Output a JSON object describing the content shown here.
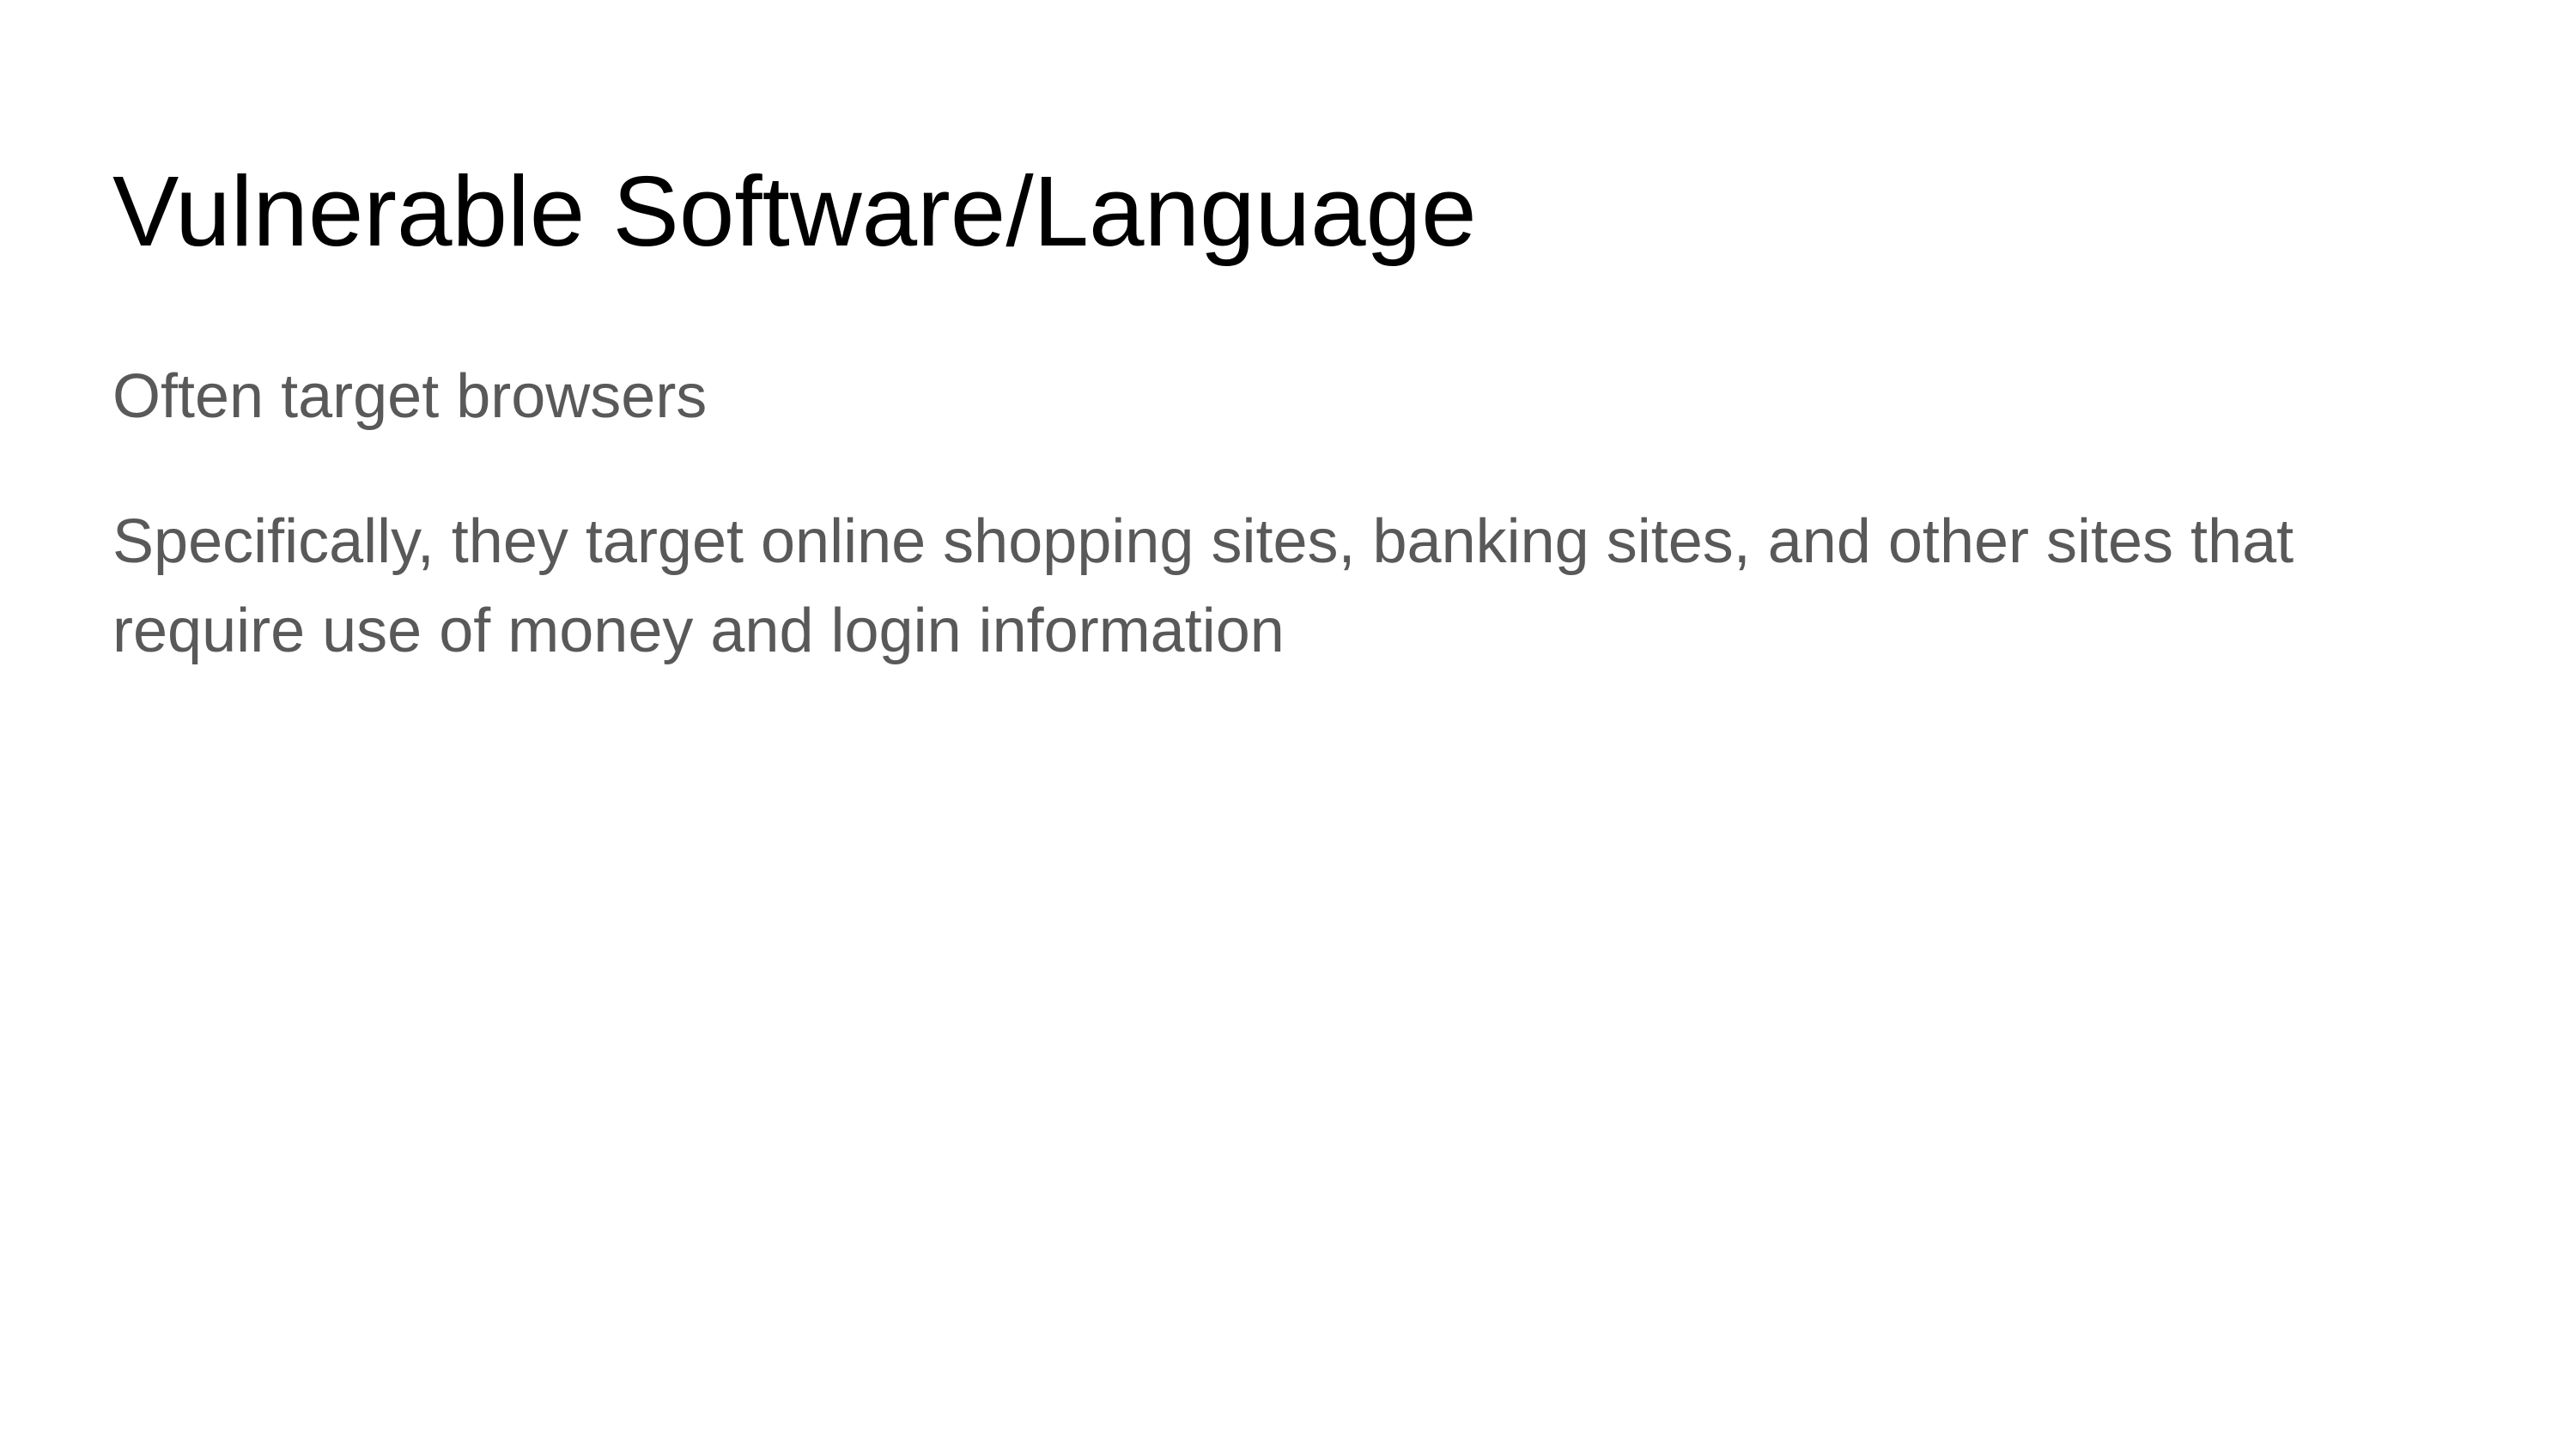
{
  "slide": {
    "title": "Vulnerable Software/Language",
    "paragraphs": [
      "Often target browsers",
      "Specifically, they target online shopping sites, banking sites, and other sites that require use of money and login information"
    ]
  },
  "colors": {
    "background": "#ffffff",
    "title_text": "#000000",
    "body_text": "#595959"
  }
}
